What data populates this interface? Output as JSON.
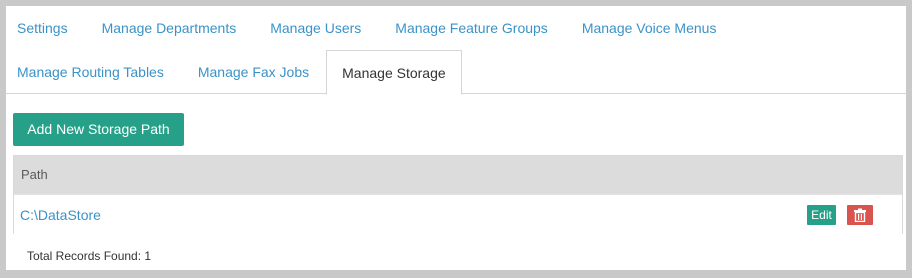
{
  "tabs": {
    "row1": [
      "Settings",
      "Manage Departments",
      "Manage Users",
      "Manage Feature Groups",
      "Manage Voice Menus"
    ],
    "row2": [
      "Manage Routing Tables",
      "Manage Fax Jobs",
      "Manage Storage"
    ],
    "active": "Manage Storage"
  },
  "toolbar": {
    "add_label": "Add New Storage Path"
  },
  "grid": {
    "columns": [
      "Path"
    ],
    "rows": [
      {
        "path": "C:\\DataStore",
        "edit_label": "Edit"
      }
    ]
  },
  "footer": {
    "total_records": "Total Records Found: 1"
  },
  "colors": {
    "accent": "#27a08a",
    "link": "#3a93c8",
    "danger": "#d9534f"
  },
  "icons": {
    "delete": "trash-icon"
  }
}
